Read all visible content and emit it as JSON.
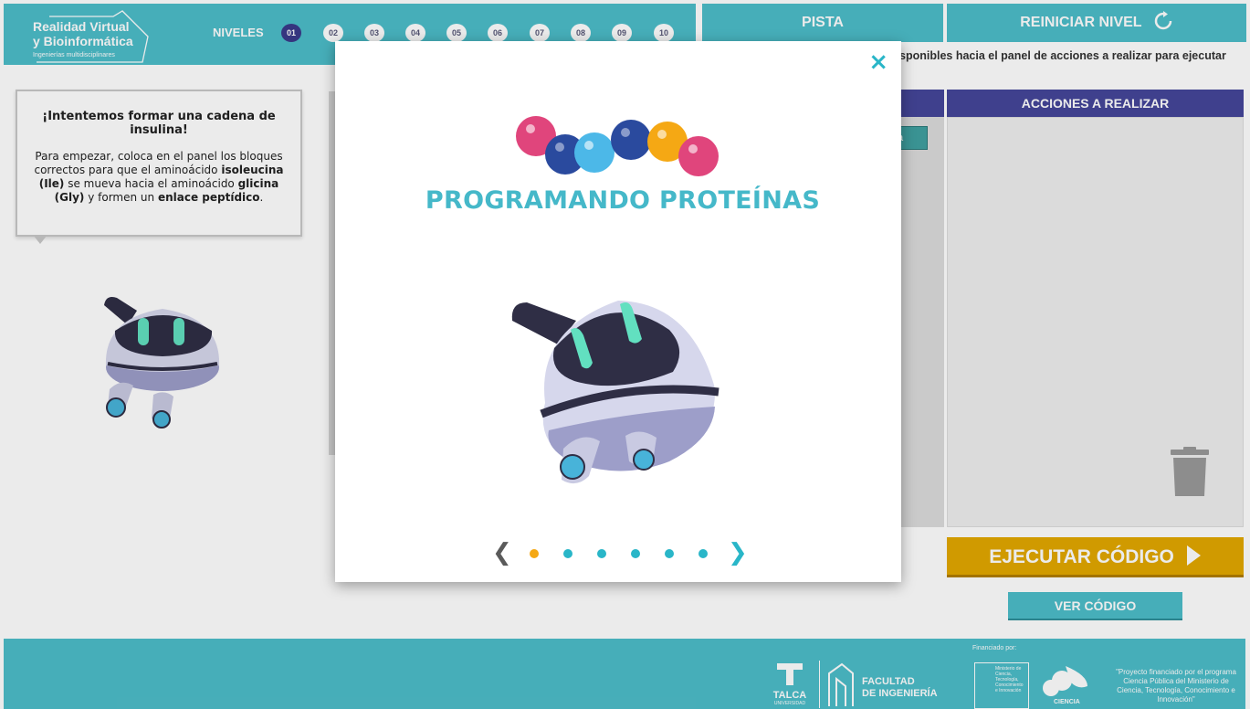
{
  "header": {
    "logo": {
      "line1": "Realidad Virtual",
      "line2": "y Bioinformática",
      "line3": "Ingenierías multidisciplinares"
    },
    "levels_label": "NIVELES",
    "levels": [
      "01",
      "02",
      "03",
      "04",
      "05",
      "06",
      "07",
      "08",
      "09",
      "10"
    ],
    "active_level": "01"
  },
  "toolbar": {
    "hint_label": "PISTA",
    "reset_label": "REINICIAR NIVEL",
    "instructions_partial": "sponibles hacia el panel de acciones a realizar para ejecutar"
  },
  "panels": {
    "actions_title": "ACCIONES A REALIZAR",
    "middle_block_partial": "a"
  },
  "buttons": {
    "execute_label": "EJECUTAR  CÓDIGO",
    "view_code_label": "VER CÓDIGO"
  },
  "bubble": {
    "title": "¡Intentemos formar una cadena de insulina!",
    "text_1": "Para empezar, coloca en el panel los bloques correctos para que el aminoácido ",
    "bold_1": "isoleucina (Ile)",
    "text_2": " se mueva hacia el aminoácido ",
    "bold_2": "glicina (Gly)",
    "text_3": " y formen un ",
    "bold_3": "enlace peptídico",
    "text_4": "."
  },
  "modal": {
    "title": "PROGRAMANDO PROTEÍNAS",
    "close_symbol": "×",
    "prev_symbol": "❮",
    "next_symbol": "❯",
    "slide_count": 6,
    "active_slide": 1
  },
  "footer": {
    "financed_by": "Financiado por:",
    "talca": "TALCA",
    "talca_sub": "UNIVERSIDAD",
    "faculty_1": "FACULTAD",
    "faculty_2": "DE INGENIERÍA",
    "ministry": "Ministerio de Ciencia, Tecnología, Conocimiento e Innovación",
    "ciencia": "CIENCIA",
    "project": "\"Proyecto financiado por el programa Ciencia Pública del Ministerio de Ciencia, Tecnología, Conocimiento e Innovación\""
  },
  "colors": {
    "teal": "#4dbdc9",
    "navy": "#45469a",
    "gold": "#e2a800",
    "dot_active": "#f5a814",
    "title_teal": "#45b8c9"
  },
  "icons": {
    "reset": "refresh-icon",
    "execute": "play-icon",
    "trash": "trash-icon",
    "close": "close-icon"
  }
}
